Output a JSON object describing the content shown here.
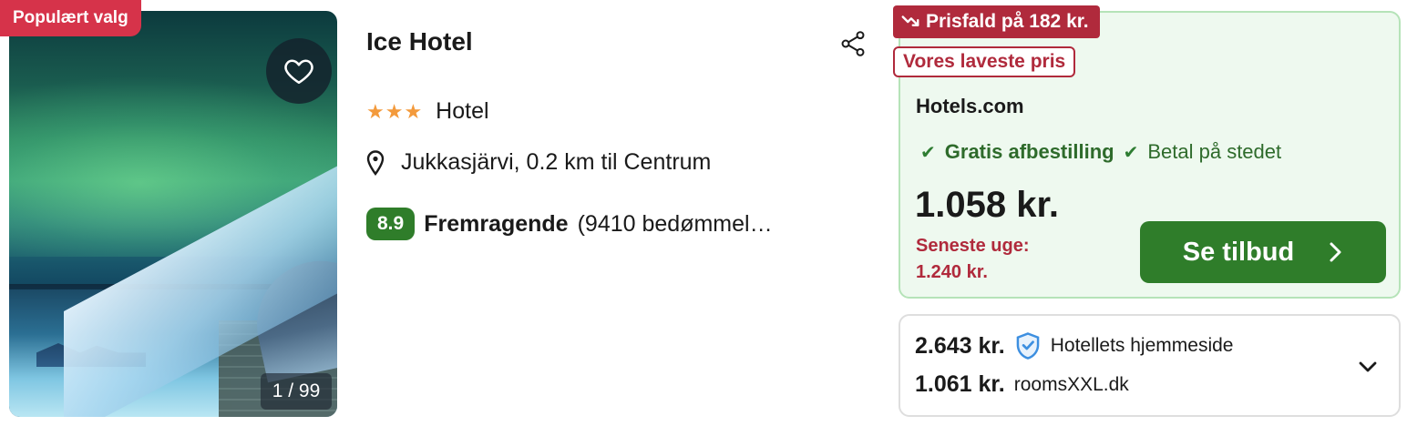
{
  "badge": {
    "label": "Populært valg"
  },
  "gallery": {
    "counter": "1 / 99"
  },
  "hotel": {
    "name": "Ice Hotel",
    "stars": 3,
    "stars_text": "★★★",
    "type": "Hotel",
    "location": "Jukkasjärvi, 0.2 km til Centrum",
    "rating_score": "8.9",
    "rating_word": "Fremragende",
    "rating_count": "(9410 bedømmel…"
  },
  "deal": {
    "price_drop": "Prisfald på 182 kr.",
    "lowest_price": "Vores laveste pris",
    "provider": "Hotels.com",
    "perk_1": "Gratis afbestilling",
    "perk_2": "Betal på stedet",
    "price": "1.058 kr.",
    "last_week_label": "Seneste uge:",
    "last_week_price": "1.240 kr.",
    "cta": "Se tilbud"
  },
  "other_offers": [
    {
      "price": "2.643 kr.",
      "site": "Hotellets hjemmeside",
      "verified": true
    },
    {
      "price": "1.061 kr.",
      "site": "roomsXXL.dk",
      "verified": false
    }
  ],
  "colors": {
    "badge_red": "#d6334a",
    "deal_red": "#b02a3c",
    "green": "#2f7d2a",
    "deal_bg": "#eef9ef",
    "star_orange": "#f39a3c"
  },
  "icons": [
    "heart-icon",
    "share-icon",
    "map-pin-icon",
    "check-icon",
    "trend-down-icon",
    "chevron-right-icon",
    "shield-check-icon",
    "chevron-down-icon"
  ]
}
